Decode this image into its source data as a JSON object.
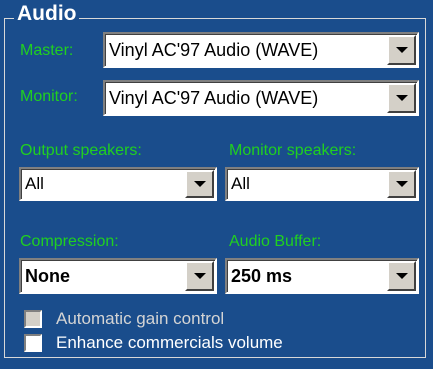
{
  "group": {
    "title": "Audio"
  },
  "master": {
    "label": "Master:",
    "value": "Vinyl AC'97 Audio (WAVE)"
  },
  "monitor": {
    "label": "Monitor:",
    "value": "Vinyl AC'97 Audio (WAVE)"
  },
  "output_speakers": {
    "label": "Output speakers:",
    "value": "All"
  },
  "monitor_speakers": {
    "label": "Monitor speakers:",
    "value": "All"
  },
  "compression": {
    "label": "Compression:",
    "value": "None"
  },
  "audio_buffer": {
    "label": "Audio Buffer:",
    "value": "250 ms"
  },
  "checkboxes": [
    {
      "label": "Automatic gain control",
      "checked": false,
      "enabled": false
    },
    {
      "label": "Enhance commercials volume",
      "checked": false,
      "enabled": true
    }
  ],
  "colors": {
    "background": "#1a4d8c",
    "label_green": "#20d020"
  },
  "icons": {
    "dropdown": "chevron-down-icon"
  }
}
